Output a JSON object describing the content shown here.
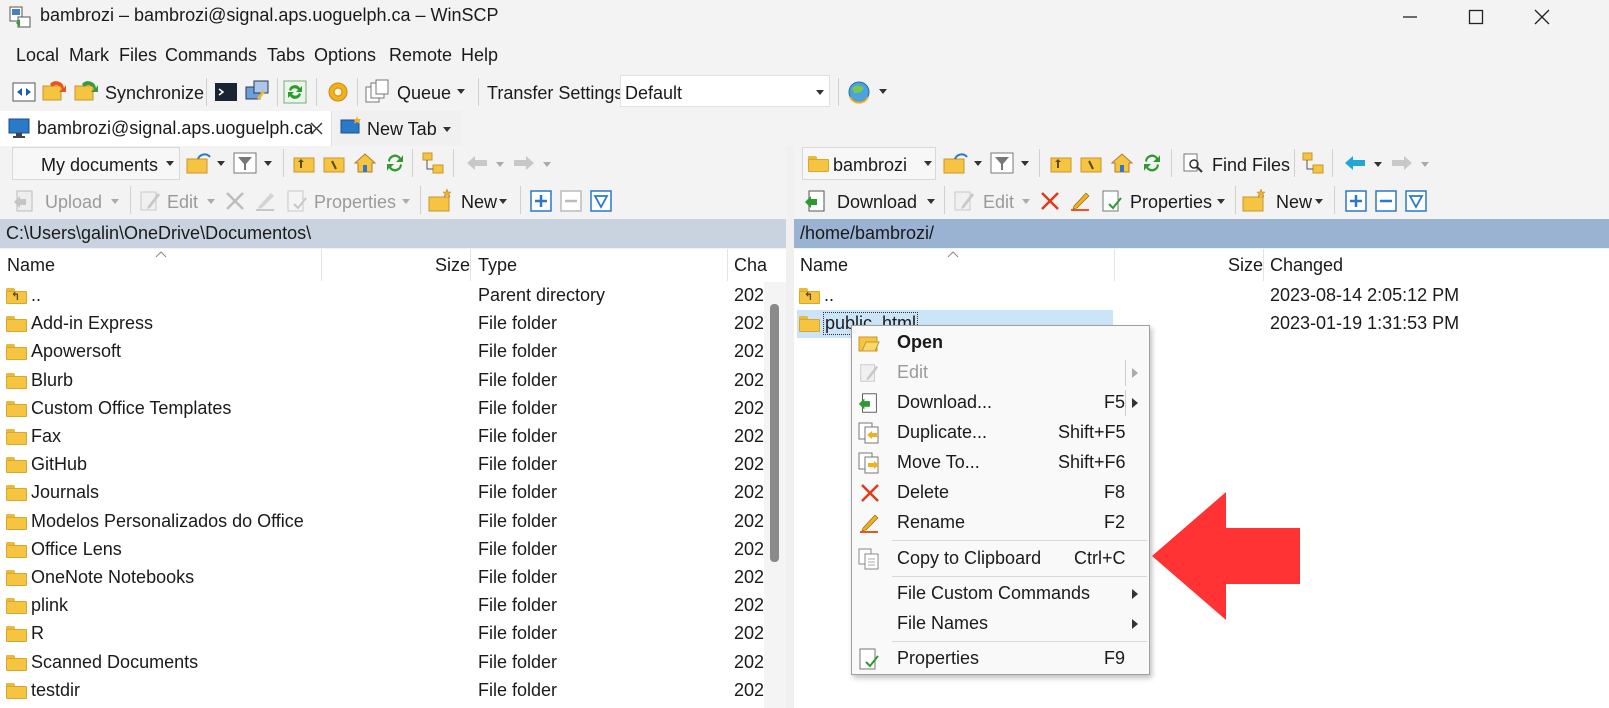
{
  "window": {
    "title": "bambrozi – bambrozi@signal.aps.uoguelph.ca – WinSCP"
  },
  "menu": [
    "Local",
    "Mark",
    "Files",
    "Commands",
    "Tabs",
    "Options",
    "Remote",
    "Help"
  ],
  "toolbar": {
    "synchronize": "Synchronize",
    "queue": "Queue",
    "transfer_settings_label": "Transfer Settings",
    "transfer_settings_value": "Default"
  },
  "tabs": [
    {
      "label": "bambrozi@signal.aps.uoguelph.ca"
    },
    {
      "label": "New Tab"
    }
  ],
  "local": {
    "location": "My documents",
    "actions": {
      "upload": "Upload",
      "edit": "Edit",
      "properties": "Properties",
      "new": "New"
    },
    "path": "C:\\Users\\galin\\OneDrive\\Documentos\\",
    "columns": {
      "name": "Name",
      "size": "Size",
      "type": "Type",
      "changed": "Cha"
    },
    "rows": [
      {
        "name": "..",
        "type": "Parent directory",
        "changed": "202"
      },
      {
        "name": "Add-in Express",
        "type": "File folder",
        "changed": "202"
      },
      {
        "name": "Apowersoft",
        "type": "File folder",
        "changed": "202"
      },
      {
        "name": "Blurb",
        "type": "File folder",
        "changed": "202"
      },
      {
        "name": "Custom Office Templates",
        "type": "File folder",
        "changed": "202"
      },
      {
        "name": "Fax",
        "type": "File folder",
        "changed": "202"
      },
      {
        "name": "GitHub",
        "type": "File folder",
        "changed": "202"
      },
      {
        "name": "Journals",
        "type": "File folder",
        "changed": "202"
      },
      {
        "name": "Modelos Personalizados do Office",
        "type": "File folder",
        "changed": "202"
      },
      {
        "name": "Office Lens",
        "type": "File folder",
        "changed": "202"
      },
      {
        "name": "OneNote Notebooks",
        "type": "File folder",
        "changed": "202"
      },
      {
        "name": "plink",
        "type": "File folder",
        "changed": "202"
      },
      {
        "name": "R",
        "type": "File folder",
        "changed": "202"
      },
      {
        "name": "Scanned Documents",
        "type": "File folder",
        "changed": "202"
      },
      {
        "name": "testdir",
        "type": "File folder",
        "changed": "202"
      }
    ]
  },
  "remote": {
    "location": "bambrozi",
    "find_files": "Find Files",
    "actions": {
      "download": "Download",
      "edit": "Edit",
      "properties": "Properties",
      "new": "New"
    },
    "path": "/home/bambrozi/",
    "columns": {
      "name": "Name",
      "size": "Size",
      "changed": "Changed"
    },
    "rows": [
      {
        "name": "..",
        "changed": "2023-08-14 2:05:12 PM"
      },
      {
        "name": "public_html",
        "changed": "2023-01-19 1:31:53 PM"
      }
    ]
  },
  "context_menu": {
    "items": [
      {
        "label": "Open",
        "shortcut": ""
      },
      {
        "label": "Edit",
        "shortcut": ""
      },
      {
        "label": "Download...",
        "shortcut": "F5"
      },
      {
        "label": "Duplicate...",
        "shortcut": "Shift+F5"
      },
      {
        "label": "Move To...",
        "shortcut": "Shift+F6"
      },
      {
        "label": "Delete",
        "shortcut": "F8"
      },
      {
        "label": "Rename",
        "shortcut": "F2"
      },
      {
        "label": "Copy to Clipboard",
        "shortcut": "Ctrl+C"
      },
      {
        "label": "File Custom Commands",
        "shortcut": ""
      },
      {
        "label": "File Names",
        "shortcut": ""
      },
      {
        "label": "Properties",
        "shortcut": "F9"
      }
    ]
  },
  "colors": {
    "pathbar_local": "#c9d3e0",
    "pathbar_remote": "#9ab3d3",
    "selection": "#cce4f7",
    "annotation_arrow": "#ff3333",
    "folder": "#f5c542"
  }
}
